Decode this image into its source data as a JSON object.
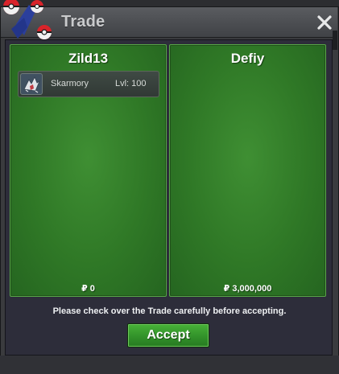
{
  "window": {
    "title": "Trade",
    "close_icon": "close-icon",
    "logo_icon": "pokeball-logo-icon"
  },
  "left_panel": {
    "player_name": "Zild13",
    "items": [
      {
        "icon": "skarmory-icon",
        "name": "Skarmory",
        "level": "Lvl: 100"
      }
    ],
    "money": "₽ 0"
  },
  "right_panel": {
    "player_name": "Defiy",
    "items": [],
    "money": "₽ 3,000,000"
  },
  "footer": {
    "notice": "Please check over the Trade carefully before accepting.",
    "accept_label": "Accept"
  },
  "colors": {
    "panel_green": "#2f7826",
    "accept_green": "#32922a",
    "background_dark": "#2d2d3a"
  }
}
